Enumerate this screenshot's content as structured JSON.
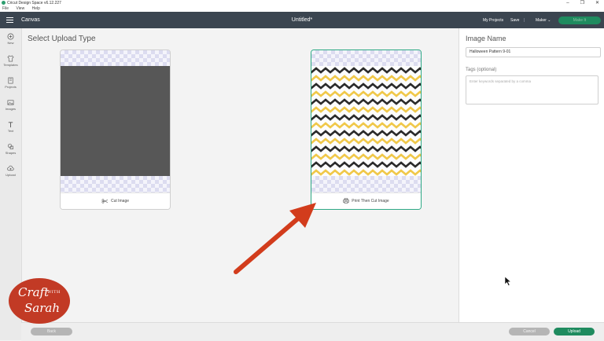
{
  "os": {
    "title": "Cricut Design Space  v6.12.227",
    "window_controls": [
      "–",
      "❐",
      "✕"
    ]
  },
  "menu": [
    "File",
    "View",
    "Help"
  ],
  "header": {
    "menu_icon": "hamburger-icon",
    "canvas_label": "Canvas",
    "doc_title": "Untitled*",
    "my_projects": "My Projects",
    "save": "Save",
    "separator": "|",
    "machine": "Maker ⌄",
    "make_button": "Make It"
  },
  "sidebar": {
    "tools": [
      {
        "label": "New",
        "icon": "plus-circle-icon"
      },
      {
        "label": "Templates",
        "icon": "shirt-icon"
      },
      {
        "label": "Projects",
        "icon": "projects-icon"
      },
      {
        "label": "Images",
        "icon": "image-icon"
      },
      {
        "label": "Text",
        "icon": "text-icon"
      },
      {
        "label": "Shapes",
        "icon": "shapes-icon"
      },
      {
        "label": "Upload",
        "icon": "cloud-upload-icon"
      }
    ]
  },
  "main": {
    "title": "Select Upload Type",
    "cards": [
      {
        "label": "Cut Image",
        "icon": "scissors-icon",
        "selected": false
      },
      {
        "label": "Print Then Cut Image",
        "icon": "printer-icon",
        "selected": true
      }
    ]
  },
  "right_panel": {
    "heading": "Image Name",
    "name_value": "Halloween Pattern 9-01",
    "tags_label": "Tags (optional)",
    "tags_placeholder": "Enter keywords separated by a comma"
  },
  "footer": {
    "back": "Back",
    "cancel": "Cancel",
    "upload": "Upload"
  },
  "logo": {
    "line1": "Craft",
    "line2": "WITH",
    "line3": "Sarah"
  },
  "colors": {
    "header_bg": "#3b4550",
    "accent_green": "#1f8b5f",
    "selected_border": "#2ea985",
    "arrow_red": "#d23c1c",
    "chevron_yellow": "#f0c84a",
    "chevron_black": "#2b2b2b"
  }
}
